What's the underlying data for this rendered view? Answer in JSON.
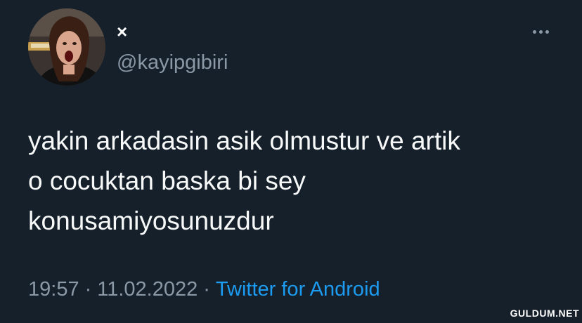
{
  "tweet": {
    "author": {
      "display_name": "×",
      "handle": "@kayipgibiri"
    },
    "more_icon": "more-horizontal-icon",
    "text_lines": [
      "yakin arkadasin asik olmustur ve artik",
      "o cocuktan baska bi sey",
      "konusamiyosunuzdur"
    ],
    "time": "19:57",
    "date": "11.02.2022",
    "separator": "·",
    "source": "Twitter for Android"
  },
  "watermark": "GULDUM.NET",
  "colors": {
    "background": "#15202b",
    "secondary_text": "#8b98a5",
    "link": "#1d9bf0"
  }
}
